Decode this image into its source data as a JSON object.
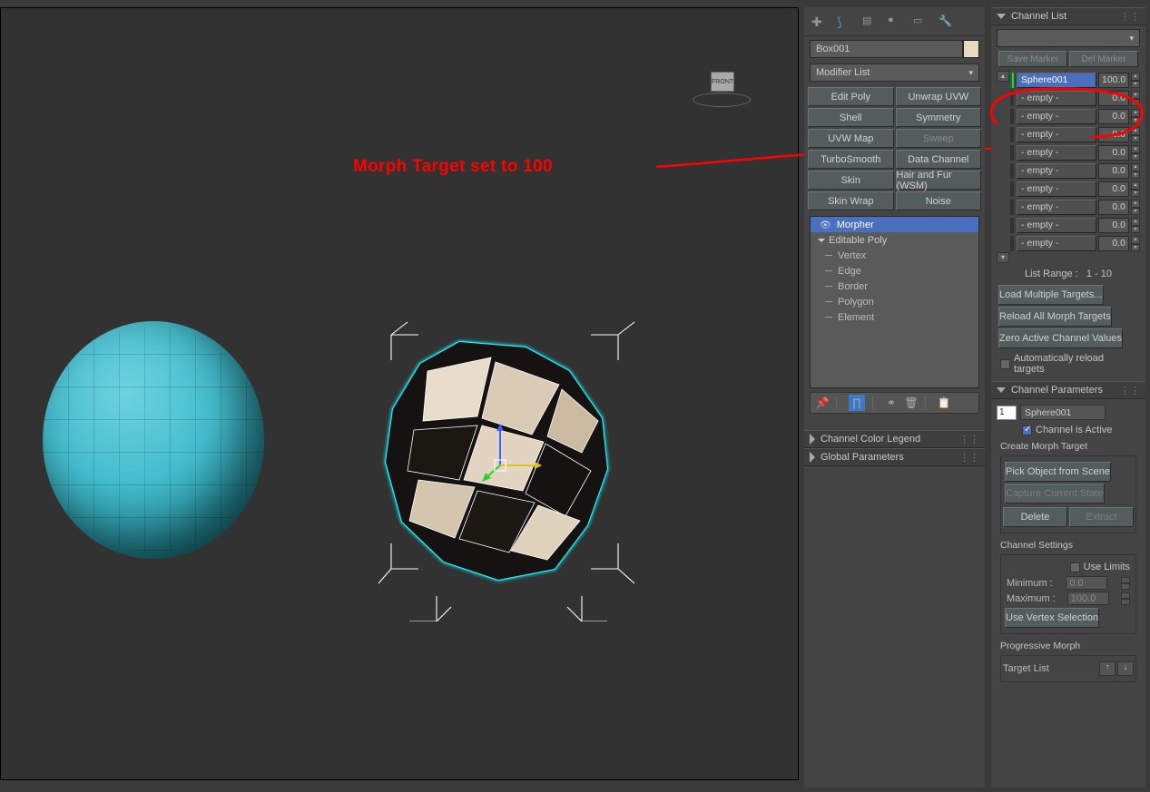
{
  "annotation": "Morph Target set to 100",
  "viewcube_label": "FRONT",
  "object_name": "Box001",
  "modifier_list_label": "Modifier List",
  "modifier_buttons": [
    "Edit Poly",
    "Unwrap UVW",
    "Shell",
    "Symmetry",
    "UVW Map",
    "Sweep",
    "TurboSmooth",
    "Data Channel",
    "Skin",
    "Hair and Fur (WSM)",
    "Skin Wrap",
    "Noise"
  ],
  "disabled_modifier_index": 5,
  "stack": {
    "selected": "Morpher",
    "root": "Editable Poly",
    "subs": [
      "Vertex",
      "Edge",
      "Border",
      "Polygon",
      "Element"
    ]
  },
  "rollouts_left": [
    "Channel Color Legend",
    "Global Parameters"
  ],
  "channel_list": {
    "title": "Channel List",
    "save_marker": "Save Marker",
    "del_marker": "Del Marker",
    "items": [
      {
        "name": "Sphere001",
        "value": "100.0",
        "active": true
      },
      {
        "name": "- empty -",
        "value": "0.0"
      },
      {
        "name": "- empty -",
        "value": "0.0"
      },
      {
        "name": "- empty -",
        "value": "0.0"
      },
      {
        "name": "- empty -",
        "value": "0.0"
      },
      {
        "name": "- empty -",
        "value": "0.0"
      },
      {
        "name": "- empty -",
        "value": "0.0"
      },
      {
        "name": "- empty -",
        "value": "0.0"
      },
      {
        "name": "- empty -",
        "value": "0.0"
      },
      {
        "name": "- empty -",
        "value": "0.0"
      }
    ],
    "range_label": "List Range :",
    "range_value": "1 - 10",
    "buttons": [
      "Load Multiple Targets...",
      "Reload All Morph Targets",
      "Zero Active Channel Values"
    ],
    "auto_reload": "Automatically reload targets"
  },
  "channel_params": {
    "title": "Channel Parameters",
    "index": "1",
    "name": "Sphere001",
    "active_label": "Channel is Active",
    "create_label": "Create Morph Target",
    "pick": "Pick Object from Scene",
    "capture": "Capture Current State",
    "delete": "Delete",
    "extract": "Extract",
    "settings_label": "Channel Settings",
    "use_limits": "Use Limits",
    "min_label": "Minimum :",
    "min_value": "0.0",
    "max_label": "Maximum :",
    "max_value": "100.0",
    "use_vertex": "Use Vertex Selection",
    "prog_label": "Progressive Morph",
    "target_list": "Target List"
  }
}
